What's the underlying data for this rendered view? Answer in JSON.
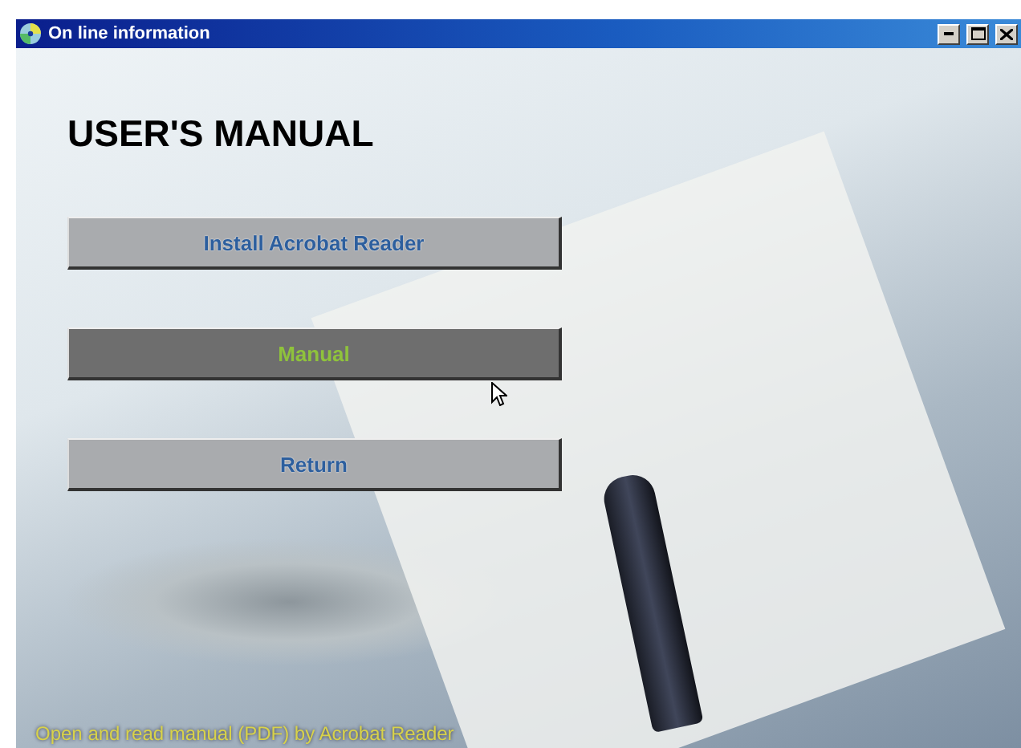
{
  "window": {
    "title": "On line information"
  },
  "heading": "USER'S MANUAL",
  "buttons": [
    {
      "label": "Install Acrobat Reader",
      "hovered": false
    },
    {
      "label": "Manual",
      "hovered": true
    },
    {
      "label": "Return",
      "hovered": false
    }
  ],
  "status_text": "Open and read manual (PDF) by Acrobat Reader"
}
